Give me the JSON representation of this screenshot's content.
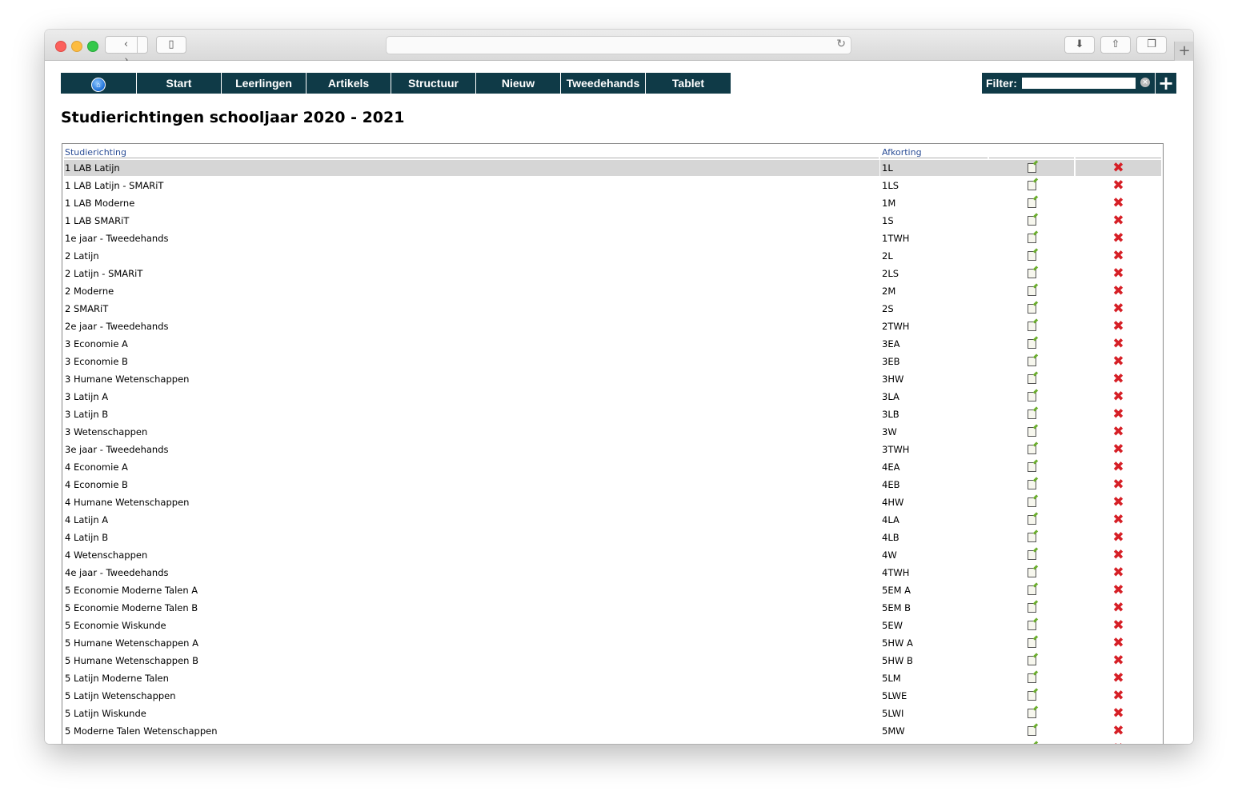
{
  "nav": {
    "home_label": "",
    "items": [
      "Start",
      "Leerlingen",
      "Artikels",
      "Structuur",
      "Nieuw",
      "Tweedehands",
      "Tablet"
    ]
  },
  "filter": {
    "label": "Filter:",
    "value": "",
    "add_label": "+"
  },
  "page": {
    "title": "Studierichtingen schooljaar 2020 - 2021"
  },
  "table": {
    "headers": {
      "name": "Studierichting",
      "abbr": "Afkorting"
    },
    "selected_row": 0,
    "rows": [
      [
        "1 LAB Latijn",
        "1L"
      ],
      [
        "1 LAB Latijn - SMARiT",
        "1LS"
      ],
      [
        "1 LAB Moderne",
        "1M"
      ],
      [
        "1 LAB SMARiT",
        "1S"
      ],
      [
        "1e jaar - Tweedehands",
        "1TWH"
      ],
      [
        "2 Latijn",
        "2L"
      ],
      [
        "2 Latijn - SMARiT",
        "2LS"
      ],
      [
        "2 Moderne",
        "2M"
      ],
      [
        "2 SMARiT",
        "2S"
      ],
      [
        "2e jaar - Tweedehands",
        "2TWH"
      ],
      [
        "3 Economie A",
        "3EA"
      ],
      [
        "3 Economie B",
        "3EB"
      ],
      [
        "3 Humane Wetenschappen",
        "3HW"
      ],
      [
        "3 Latijn A",
        "3LA"
      ],
      [
        "3 Latijn B",
        "3LB"
      ],
      [
        "3 Wetenschappen",
        "3W"
      ],
      [
        "3e jaar - Tweedehands",
        "3TWH"
      ],
      [
        "4 Economie A",
        "4EA"
      ],
      [
        "4 Economie B",
        "4EB"
      ],
      [
        "4 Humane Wetenschappen",
        "4HW"
      ],
      [
        "4 Latijn A",
        "4LA"
      ],
      [
        "4 Latijn B",
        "4LB"
      ],
      [
        "4 Wetenschappen",
        "4W"
      ],
      [
        "4e jaar - Tweedehands",
        "4TWH"
      ],
      [
        "5 Economie Moderne Talen A",
        "5EM A"
      ],
      [
        "5 Economie Moderne Talen B",
        "5EM B"
      ],
      [
        "5 Economie Wiskunde",
        "5EW"
      ],
      [
        "5 Humane Wetenschappen A",
        "5HW A"
      ],
      [
        "5 Humane Wetenschappen B",
        "5HW B"
      ],
      [
        "5 Latijn Moderne Talen",
        "5LM"
      ],
      [
        "5 Latijn Wetenschappen",
        "5LWE"
      ],
      [
        "5 Latijn Wiskunde",
        "5LWI"
      ],
      [
        "5 Moderne Talen Wetenschappen",
        "5MW"
      ],
      [
        "",
        ""
      ]
    ],
    "edit_icon": "edit-icon",
    "delete_icon": "delete-icon",
    "delete_color": "#d61f26"
  },
  "colors": {
    "nav_bg": "#0f3a47",
    "header_link": "#2a4d96",
    "selected_row": "#d6d6d6"
  }
}
